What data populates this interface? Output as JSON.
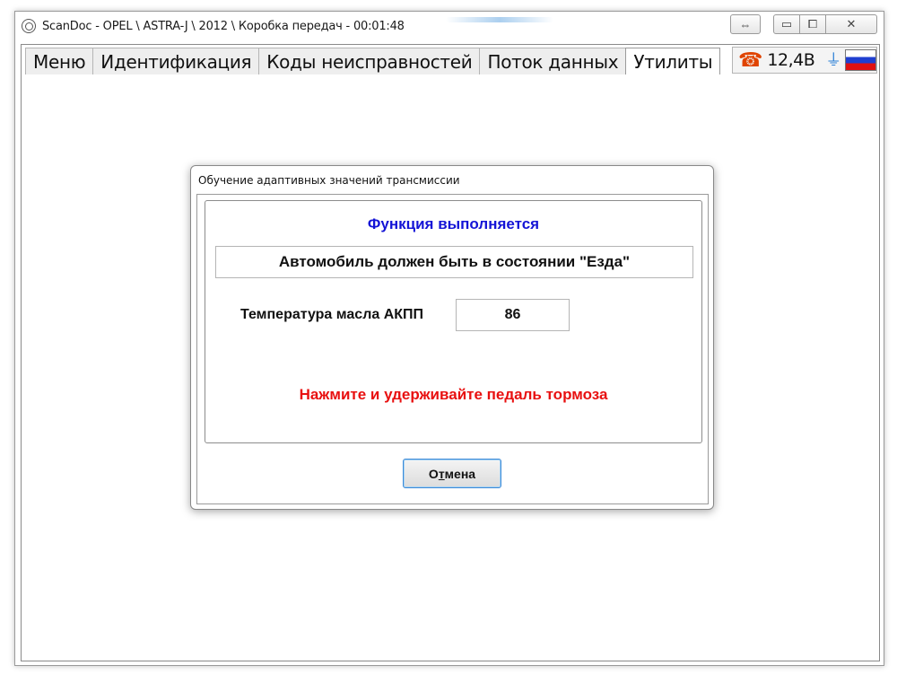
{
  "window": {
    "title": "ScanDoc - OPEL \\ ASTRA-J \\ 2012 \\ Коробка передач - 00:01:48",
    "controls": {
      "swap": "⇔",
      "minimize": "▭",
      "maximize": "⧠",
      "close": "✕"
    }
  },
  "tabs": [
    {
      "label": "Меню",
      "active": false
    },
    {
      "label": "Идентификация",
      "active": false
    },
    {
      "label": "Коды неисправностей",
      "active": false
    },
    {
      "label": "Поток данных",
      "active": false
    },
    {
      "label": "Утилиты",
      "active": true
    }
  ],
  "status": {
    "phone_icon": "phone-icon",
    "voltage": "12,4В",
    "plug_icon": "plug-icon",
    "flag": "russia-flag"
  },
  "dialog": {
    "title": "Обучение адаптивных значений трансмиссии",
    "status_line": "Функция выполняется",
    "instruction": "Автомобиль должен быть в состоянии \"Езда\"",
    "temperature": {
      "label": "Температура масла АКПП",
      "value": "86"
    },
    "warning": "Нажмите и удерживайте педаль тормоза",
    "cancel": {
      "before": "О",
      "underlined": "т",
      "after": "мена"
    }
  },
  "colors": {
    "status_line": "#1414d6",
    "warning": "#e81010",
    "phone": "#e04400",
    "plug": "#2a7fd6"
  }
}
